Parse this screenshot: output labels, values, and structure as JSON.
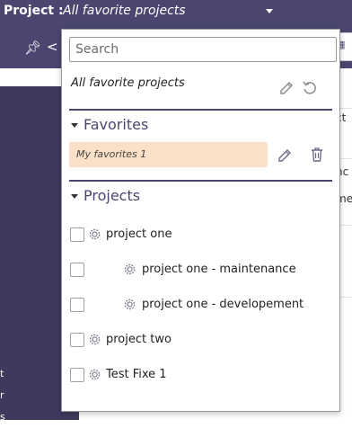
{
  "header": {
    "label": "Project :",
    "current_value": "All favorite projects"
  },
  "background": {
    "side_ticks": [
      "t",
      "r",
      "s"
    ],
    "right_tab_icon": "columns-icon",
    "right_fragments": [
      "ct",
      "nc",
      "me"
    ]
  },
  "dropdown": {
    "search_placeholder": "Search",
    "current_selection": "All favorite projects",
    "favorites": {
      "title": "Favorites",
      "items": [
        {
          "name": "My favorites 1"
        }
      ]
    },
    "projects": {
      "title": "Projects",
      "items": [
        {
          "name": "project one",
          "level": 0
        },
        {
          "name": "project one - maintenance",
          "level": 1
        },
        {
          "name": "project one - developement",
          "level": 1
        },
        {
          "name": "project two",
          "level": 0
        },
        {
          "name": "Test Fixe 1",
          "level": 0
        }
      ]
    }
  },
  "colors": {
    "header_bg": "#4a4670",
    "accent": "#4a4670",
    "favorite_highlight": "#fbe0c8"
  }
}
